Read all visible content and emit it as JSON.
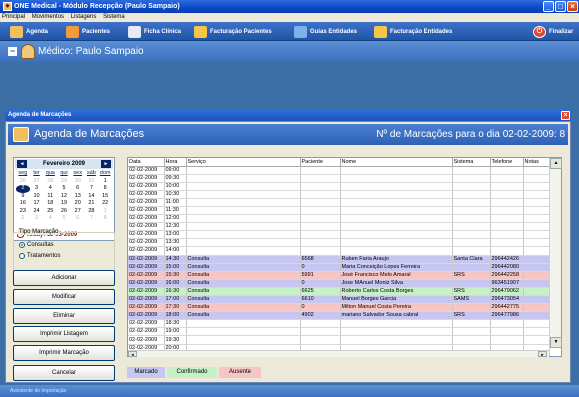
{
  "window": {
    "title": "ONE Medical - Módulo Recepção (Paulo Sampaio)",
    "icon": "app-icon",
    "controls": [
      "minimize-icon",
      "maximize-icon",
      "close-icon"
    ]
  },
  "menu": [
    "Principal",
    "Movimentos",
    "Listagens",
    "Sistema"
  ],
  "toolbar": [
    {
      "label": "Agenda",
      "icon": "calendar-icon"
    },
    {
      "label": "Pacientes",
      "icon": "patients-icon"
    },
    {
      "label": "Ficha Clínica",
      "icon": "clinical-file-icon"
    },
    {
      "label": "Facturação Pacientes",
      "icon": "billing-icon"
    },
    {
      "label": "Guias Entidades",
      "icon": "guides-icon"
    },
    {
      "label": "Facturação Entidades",
      "icon": "entity-billing-icon"
    },
    {
      "label": "Finalizar",
      "icon": "power-icon"
    }
  ],
  "medico": {
    "label": "Médico: Paulo Sampaio"
  },
  "dialog": {
    "title": "Agenda de Marcações",
    "header": "Agenda de Marcações",
    "count_text": "Nº de Marcações para o dia 02-02-2009: 8"
  },
  "calendar": {
    "month": "Fevereiro 2009",
    "prev": "◄",
    "next": "►",
    "weekdays": [
      "seg",
      "ter",
      "qua",
      "qui",
      "sex",
      "sáb",
      "dom"
    ],
    "weeks": [
      [
        "26",
        "27",
        "28",
        "29",
        "30",
        "31",
        "1"
      ],
      [
        "2",
        "3",
        "4",
        "5",
        "6",
        "7",
        "8"
      ],
      [
        "9",
        "10",
        "11",
        "12",
        "13",
        "14",
        "15"
      ],
      [
        "16",
        "17",
        "18",
        "19",
        "20",
        "21",
        "22"
      ],
      [
        "23",
        "24",
        "25",
        "26",
        "27",
        "28",
        "1"
      ],
      [
        "2",
        "3",
        "4",
        "5",
        "6",
        "7",
        "8"
      ]
    ],
    "today": "Today: 11-03-2009"
  },
  "tipo": {
    "legend": "Tipo Marcação",
    "options": [
      {
        "label": "Consultas",
        "selected": true
      },
      {
        "label": "Tratamentos",
        "selected": false
      }
    ]
  },
  "buttons": {
    "adicionar": "Adicionar",
    "modificar": "Modificar",
    "eliminar": "Eliminar",
    "imprimir_listagem": "Imprimir Listagem",
    "imprimir_marcacao": "Imprimir Marcação",
    "cancelar": "Cancelar"
  },
  "table": {
    "columns": [
      "Data",
      "Hora",
      "Serviço",
      "Paciente",
      "Nome",
      "Sistema",
      "Telefone",
      "Notas"
    ],
    "rows": [
      {
        "data": "02-02-2009",
        "hora": "09:00",
        "servico": "",
        "paciente": "",
        "nome": "",
        "sistema": "",
        "telefone": "",
        "status": ""
      },
      {
        "data": "02-02-2009",
        "hora": "09:30",
        "servico": "",
        "paciente": "",
        "nome": "",
        "sistema": "",
        "telefone": "",
        "status": ""
      },
      {
        "data": "02-02-2009",
        "hora": "10:00",
        "servico": "",
        "paciente": "",
        "nome": "",
        "sistema": "",
        "telefone": "",
        "status": ""
      },
      {
        "data": "02-02-2009",
        "hora": "10:30",
        "servico": "",
        "paciente": "",
        "nome": "",
        "sistema": "",
        "telefone": "",
        "status": ""
      },
      {
        "data": "02-02-2009",
        "hora": "11:00",
        "servico": "",
        "paciente": "",
        "nome": "",
        "sistema": "",
        "telefone": "",
        "status": ""
      },
      {
        "data": "02-02-2009",
        "hora": "11:30",
        "servico": "",
        "paciente": "",
        "nome": "",
        "sistema": "",
        "telefone": "",
        "status": ""
      },
      {
        "data": "02-02-2009",
        "hora": "12:00",
        "servico": "",
        "paciente": "",
        "nome": "",
        "sistema": "",
        "telefone": "",
        "status": ""
      },
      {
        "data": "02-02-2009",
        "hora": "12:30",
        "servico": "",
        "paciente": "",
        "nome": "",
        "sistema": "",
        "telefone": "",
        "status": ""
      },
      {
        "data": "02-02-2009",
        "hora": "13:00",
        "servico": "",
        "paciente": "",
        "nome": "",
        "sistema": "",
        "telefone": "",
        "status": ""
      },
      {
        "data": "02-02-2009",
        "hora": "13:30",
        "servico": "",
        "paciente": "",
        "nome": "",
        "sistema": "",
        "telefone": "",
        "status": ""
      },
      {
        "data": "02-02-2009",
        "hora": "14:00",
        "servico": "",
        "paciente": "",
        "nome": "",
        "sistema": "",
        "telefone": "",
        "status": ""
      },
      {
        "data": "02-02-2009",
        "hora": "14:30",
        "servico": "Consulta",
        "paciente": "6568",
        "nome": "Ruben Faria Araujo",
        "sistema": "Santa Clara",
        "telefone": "296442426",
        "status": "marcado"
      },
      {
        "data": "02-02-2009",
        "hora": "15:00",
        "servico": "Consulta",
        "paciente": "0",
        "nome": "Maria Conceição Lopes Ferreira",
        "sistema": "",
        "telefone": "296442080",
        "status": "marcado"
      },
      {
        "data": "02-02-2009",
        "hora": "15:30",
        "servico": "Consulta",
        "paciente": "5991",
        "nome": "José Francisco Melo Amaral",
        "sistema": "SRS",
        "telefone": "296442258",
        "status": "ausente"
      },
      {
        "data": "02-02-2009",
        "hora": "16:00",
        "servico": "Consulta",
        "paciente": "0",
        "nome": "Jose MAnuel Moniz Silva",
        "sistema": "",
        "telefone": "963451907",
        "status": "marcado"
      },
      {
        "data": "02-02-2009",
        "hora": "16:30",
        "servico": "Consulta",
        "paciente": "6625",
        "nome": "Roberto Carlos Costa Borges",
        "sistema": "SRS",
        "telefone": "296479062",
        "status": "confirmado"
      },
      {
        "data": "02-02-2009",
        "hora": "17:00",
        "servico": "Consulta",
        "paciente": "6610",
        "nome": "Manuel Borges Garcia",
        "sistema": "SAMS",
        "telefone": "296473054",
        "status": "marcado"
      },
      {
        "data": "02-02-2009",
        "hora": "17:30",
        "servico": "Consulta",
        "paciente": "0",
        "nome": "Milton Manuel Costa Pereira",
        "sistema": "",
        "telefone": "296442775",
        "status": "ausente"
      },
      {
        "data": "02-02-2009",
        "hora": "18:00",
        "servico": "Consulta",
        "paciente": "4902",
        "nome": "mariano Salvador Sousa cabral",
        "sistema": "SRS",
        "telefone": "296477986",
        "status": "marcado"
      },
      {
        "data": "02-02-2009",
        "hora": "18:30",
        "servico": "",
        "paciente": "",
        "nome": "",
        "sistema": "",
        "telefone": "",
        "status": ""
      },
      {
        "data": "02-02-2009",
        "hora": "19:00",
        "servico": "",
        "paciente": "",
        "nome": "",
        "sistema": "",
        "telefone": "",
        "status": ""
      },
      {
        "data": "02-02-2009",
        "hora": "19:30",
        "servico": "",
        "paciente": "",
        "nome": "",
        "sistema": "",
        "telefone": "",
        "status": ""
      },
      {
        "data": "02-02-2009",
        "hora": "20:00",
        "servico": "",
        "paciente": "",
        "nome": "",
        "sistema": "",
        "telefone": "",
        "status": ""
      },
      {
        "data": "02-02-2009",
        "hora": "20:30",
        "servico": "",
        "paciente": "",
        "nome": "",
        "sistema": "",
        "telefone": "",
        "status": ""
      }
    ]
  },
  "legend": [
    {
      "label": "Marcado",
      "color": "#c6c6f0"
    },
    {
      "label": "Confirmado",
      "color": "#c6f0c6"
    },
    {
      "label": "Ausente",
      "color": "#f6c6c6"
    }
  ],
  "status_bar": {
    "text": "Assistente de Importação"
  }
}
